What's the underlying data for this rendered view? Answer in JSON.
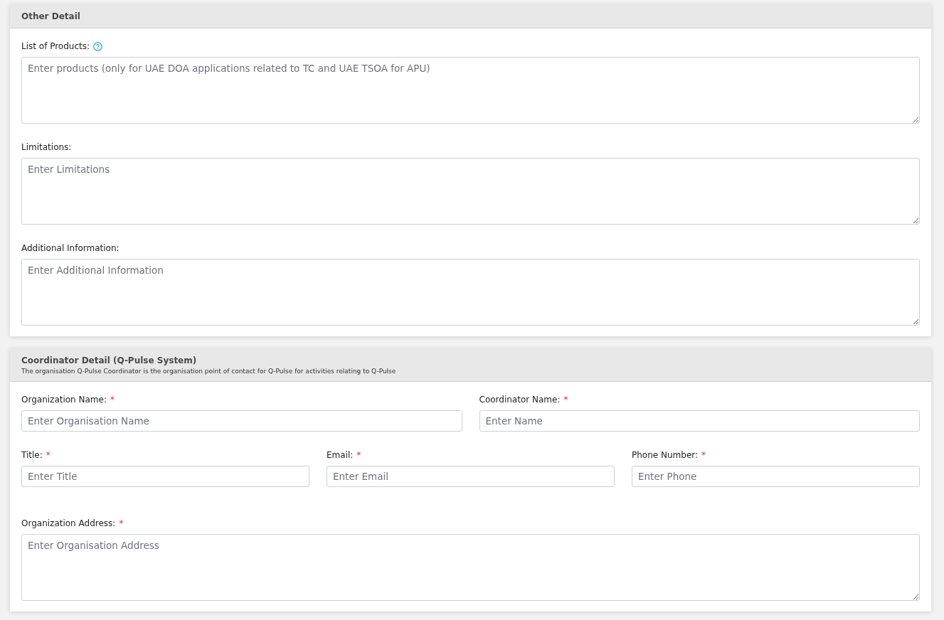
{
  "sections": [
    {
      "title": "Other Detail",
      "rows": [
        [
          {
            "kind": "textarea",
            "label": "List of Products:",
            "help": true,
            "placeholder": "Enter products (only for UAE DOA applications related to TC and UAE TSOA for APU)"
          }
        ],
        [
          {
            "kind": "textarea",
            "label": "Limitations:",
            "placeholder": "Enter Limitations"
          }
        ],
        [
          {
            "kind": "textarea",
            "label": "Additional Information:",
            "placeholder": "Enter Additional Information"
          }
        ]
      ]
    },
    {
      "title": "Coordinator Detail (Q-Pulse System)",
      "subtitle": "The organisation Q-Pulse Coordinator is the organisation point of contact for Q-Pulse for activities relating to Q-Pulse",
      "rows": [
        [
          {
            "kind": "input",
            "label": "Organization Name:",
            "required_mark": "*",
            "placeholder": "Enter Organisation Name"
          },
          {
            "kind": "input",
            "label": "Coordinator Name:",
            "required_mark": "*",
            "placeholder": "Enter Name"
          }
        ],
        [
          {
            "kind": "input",
            "label": "Title:",
            "required_mark": "*",
            "placeholder": "Enter Title"
          },
          {
            "kind": "input",
            "label": "Email:",
            "required_mark": "*",
            "placeholder": "Enter Email"
          },
          {
            "kind": "input",
            "label": "Phone Number:",
            "required_mark": "*",
            "placeholder": "Enter Phone"
          }
        ],
        [
          {
            "kind": "textarea",
            "label": "Organization Address:",
            "required_mark": "*",
            "placeholder": "Enter Organisation Address"
          }
        ]
      ]
    }
  ]
}
